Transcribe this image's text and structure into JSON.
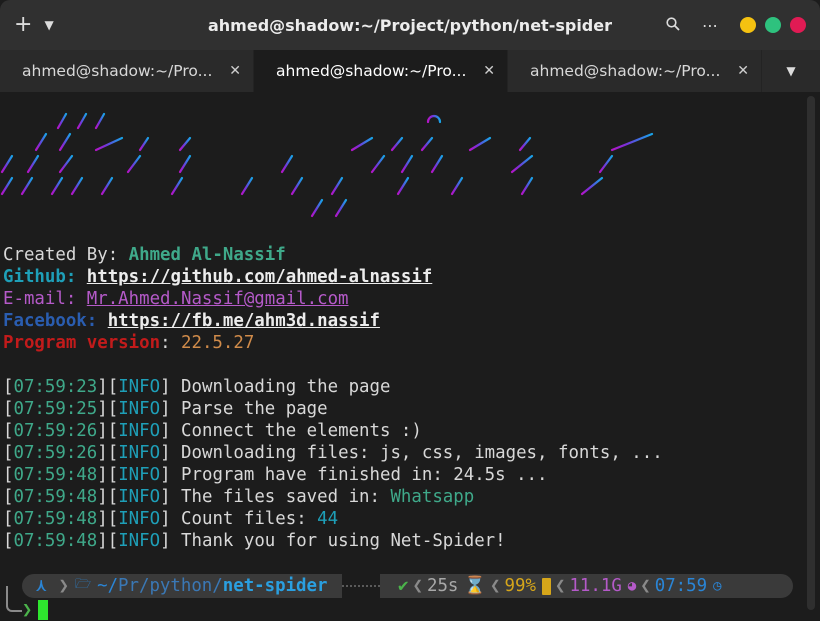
{
  "window": {
    "title": "ahmed@shadow:~/Project/python/net-spider"
  },
  "tabs": [
    {
      "label": "ahmed@shadow:~/Pro...",
      "active": false
    },
    {
      "label": "ahmed@shadow:~/Pro...",
      "active": true
    },
    {
      "label": "ahmed@shadow:~/Pro...",
      "active": false
    }
  ],
  "banner": {
    "art_text": "Net Spider"
  },
  "info": {
    "created_label": "Created By: ",
    "created_value": "Ahmed Al-Nassif",
    "github_label": "Github: ",
    "github_value": "https://github.com/ahmed-alnassif",
    "email_label": "E-mail: ",
    "email_value": "Mr.Ahmed.Nassif@gmail.com",
    "facebook_label": "Facebook: ",
    "facebook_value": "https://fb.me/ahm3d.nassif",
    "version_label": "Program version",
    "version_colon": ": ",
    "version_value": "22.5.27"
  },
  "log": [
    {
      "time": "07:59:23",
      "level": "INFO",
      "message": "Downloading the page",
      "value": ""
    },
    {
      "time": "07:59:25",
      "level": "INFO",
      "message": "Parse the page",
      "value": ""
    },
    {
      "time": "07:59:26",
      "level": "INFO",
      "message": "Connect the elements :)",
      "value": ""
    },
    {
      "time": "07:59:26",
      "level": "INFO",
      "message": "Downloading files: js, css, images, fonts, ...",
      "value": ""
    },
    {
      "time": "07:59:48",
      "level": "INFO",
      "message": "Program have finished in: 24.5s ...",
      "value": ""
    },
    {
      "time": "07:59:48",
      "level": "INFO",
      "message": "The files saved in: ",
      "value": "Whatsapp"
    },
    {
      "time": "07:59:48",
      "level": "INFO",
      "message": "Count files: ",
      "value": "44"
    },
    {
      "time": "07:59:48",
      "level": "INFO",
      "message": "Thank you for using Net-Spider!",
      "value": ""
    }
  ],
  "prompt": {
    "os_icon": "arch-icon",
    "folder_icon": "folder-icon",
    "path_home": "~/",
    "path_dim": "Pr/python/",
    "path_current": "net-spider",
    "status_ok": "✔",
    "duration": "25s",
    "battery": "99%",
    "memory": "11.1G",
    "clock": "07:59",
    "prompt_char": "❯"
  },
  "colors": {
    "accent_green": "#3fa98a",
    "accent_cyan": "#1e9fb8",
    "cursor": "#2ee62e"
  }
}
